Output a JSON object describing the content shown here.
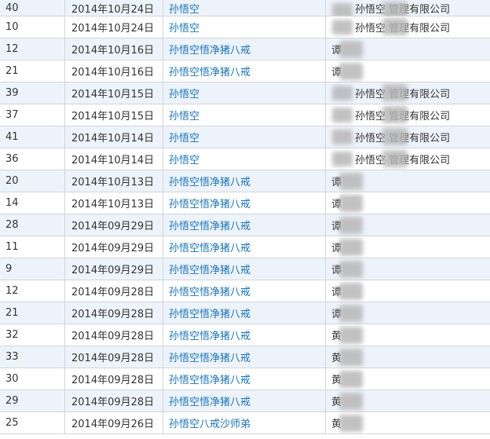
{
  "rows": [
    {
      "id": "40",
      "date": "2014年10月24日",
      "title": "孙悟空",
      "org": "孙悟空 管理有限公司",
      "org_style": "company"
    },
    {
      "id": "10",
      "date": "2014年10月24日",
      "title": "孙悟空",
      "org": "孙悟空 管理有限公司",
      "org_style": "company"
    },
    {
      "id": "12",
      "date": "2014年10月16日",
      "title": "孙悟空悟净猪八戒",
      "org": "谭",
      "org_style": "person"
    },
    {
      "id": "21",
      "date": "2014年10月16日",
      "title": "孙悟空悟净猪八戒",
      "org": "谭",
      "org_style": "person"
    },
    {
      "id": "39",
      "date": "2014年10月15日",
      "title": "孙悟空",
      "org": "孙悟空 管理有限公司",
      "org_style": "company"
    },
    {
      "id": "37",
      "date": "2014年10月15日",
      "title": "孙悟空",
      "org": "孙悟空 管理有限公司",
      "org_style": "company"
    },
    {
      "id": "41",
      "date": "2014年10月14日",
      "title": "孙悟空",
      "org": "孙悟空 管理有限公司",
      "org_style": "company"
    },
    {
      "id": "36",
      "date": "2014年10月14日",
      "title": "孙悟空",
      "org": "孙悟空 管理有限公司",
      "org_style": "company"
    },
    {
      "id": "20",
      "date": "2014年10月13日",
      "title": "孙悟空悟净猪八戒",
      "org": "谭",
      "org_style": "person"
    },
    {
      "id": "14",
      "date": "2014年10月13日",
      "title": "孙悟空悟净猪八戒",
      "org": "谭",
      "org_style": "person"
    },
    {
      "id": "28",
      "date": "2014年09月29日",
      "title": "孙悟空悟净猪八戒",
      "org": "谭",
      "org_style": "person"
    },
    {
      "id": "11",
      "date": "2014年09月29日",
      "title": "孙悟空悟净猪八戒",
      "org": "谭",
      "org_style": "person"
    },
    {
      "id": "9",
      "date": "2014年09月29日",
      "title": "孙悟空悟净猪八戒",
      "org": "谭",
      "org_style": "person"
    },
    {
      "id": "12",
      "date": "2014年09月28日",
      "title": "孙悟空悟净猪八戒",
      "org": "谭",
      "org_style": "person"
    },
    {
      "id": "21",
      "date": "2014年09月28日",
      "title": "孙悟空悟净猪八戒",
      "org": "谭",
      "org_style": "person"
    },
    {
      "id": "32",
      "date": "2014年09月28日",
      "title": "孙悟空悟净猪八戒",
      "org": "黄",
      "org_style": "person"
    },
    {
      "id": "33",
      "date": "2014年09月28日",
      "title": "孙悟空悟净猪八戒",
      "org": "黄",
      "org_style": "person"
    },
    {
      "id": "30",
      "date": "2014年09月28日",
      "title": "孙悟空悟净猪八戒",
      "org": "黄",
      "org_style": "person"
    },
    {
      "id": "29",
      "date": "2014年09月28日",
      "title": "孙悟空悟净猪八戒",
      "org": "黄",
      "org_style": "person"
    },
    {
      "id": "25",
      "date": "2014年09月26日",
      "title": "孙悟空八戒沙师弟",
      "org": "黄",
      "org_style": "person"
    }
  ]
}
